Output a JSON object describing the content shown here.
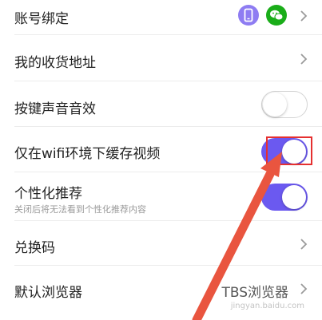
{
  "settings": {
    "rows": [
      {
        "label": "账号绑定"
      },
      {
        "label": "我的收货地址"
      },
      {
        "label": "按键声音音效"
      },
      {
        "label": "仅在wifi环境下缓存视频"
      },
      {
        "label": "个性化推荐",
        "sublabel": "关闭后将无法看到个性化推荐内容"
      },
      {
        "label": "兑换码"
      },
      {
        "label": "默认浏览器",
        "value": "TBS浏览器"
      }
    ]
  },
  "toggles": {
    "key_sound": false,
    "wifi_only_cache": true,
    "personalized_recommendation": true
  },
  "icons": {
    "phone": "phone-icon",
    "wechat": "wechat-icon",
    "chevron": "chevron-right-icon"
  },
  "colors": {
    "toggle_on": "#6b59f0",
    "phone_badge": "#8e7cf2",
    "wechat_badge": "#1aad19",
    "annotation": "#e53030"
  },
  "watermark": "jingyan.baidu.com"
}
